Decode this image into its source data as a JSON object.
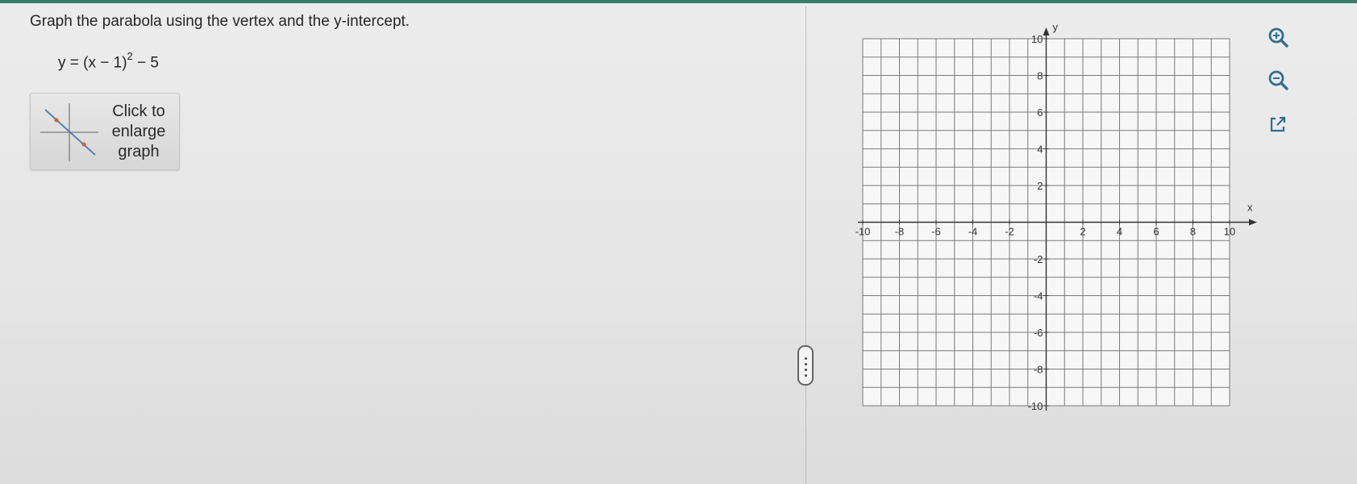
{
  "problem": {
    "instruction": "Graph the parabola using the vertex and the y-intercept.",
    "equation_main": "y = (x − 1)",
    "equation_exponent": "2",
    "equation_tail": " − 5"
  },
  "enlarge_button": {
    "line1": "Click to",
    "line2": "enlarge",
    "line3": "graph"
  },
  "graph": {
    "x_axis_label": "x",
    "y_axis_label": "y",
    "x_range": [
      -10,
      10
    ],
    "y_range": [
      -10,
      10
    ],
    "grid_step": 1,
    "x_tick_labels": [
      "-10",
      "-8",
      "-6",
      "-4",
      "-2",
      "2",
      "4",
      "6",
      "8",
      "10"
    ],
    "x_tick_values": [
      -10,
      -8,
      -6,
      -4,
      -2,
      2,
      4,
      6,
      8,
      10
    ],
    "y_tick_labels": [
      "10",
      "8",
      "6",
      "4",
      "2",
      "-2",
      "-4",
      "-6",
      "-8",
      "-10"
    ],
    "y_tick_values": [
      10,
      8,
      6,
      4,
      2,
      -2,
      -4,
      -6,
      -8,
      -10
    ],
    "grid_color": "#7a7a7a",
    "axis_color": "#333333"
  },
  "toolbar": {
    "zoom_in_icon": "zoom-in-icon",
    "zoom_out_icon": "zoom-out-icon",
    "open_external_icon": "external-link-icon"
  }
}
